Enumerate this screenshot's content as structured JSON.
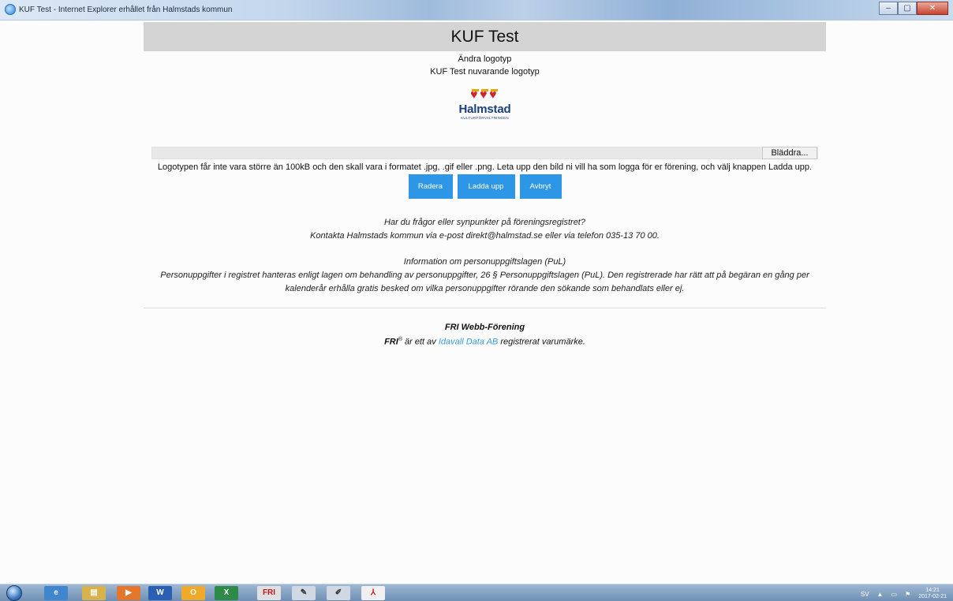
{
  "window": {
    "title": "KUF Test - Internet Explorer erhållet från Halmstads kommun",
    "controls": [
      "–",
      "▢",
      "✕"
    ]
  },
  "header": {
    "title": "KUF Test"
  },
  "logo_section": {
    "change_logo": "Ändra logotyp",
    "current_logo_label": "KUF Test nuvarande logotyp",
    "logo_name": "Halmstad",
    "logo_sub": "KULTURFÖRVALTNINGEN"
  },
  "upload": {
    "browse_label": "Bläddra...",
    "info_text": "Logotypen får inte vara större än 100kB och den skall vara i formatet .jpg, .gif eller .png. Leta upp den bild ni vill ha som logga för er förening, och välj knappen Ladda upp."
  },
  "buttons": {
    "delete": "Radera",
    "upload": "Ladda upp",
    "cancel": "Avbryt",
    "color": "#2d96e6"
  },
  "contact": {
    "line1": "Har du frågor eller synpunkter på föreningsregistret?",
    "line2": "Kontakta Halmstads kommun via e-post direkt@halmstad.se eller via telefon 035-13 70 00."
  },
  "pul": {
    "heading": "Information om personuppgiftslagen (PuL)",
    "text": "Personuppgifter i registret hanteras enligt lagen om behandling av personuppgifter, 26 § Personuppgiftslagen (PuL). Den registrerade har rätt att på begäran en gång per kalenderår erhålla gratis besked om vilka personuppgifter rörande den sökande som behandlats eller ej."
  },
  "footer": {
    "product": "FRI Webb-Förening",
    "brand": "FRI",
    "reg_mark": "®",
    "text_before": " är ett av ",
    "company_link": "Idavall Data AB",
    "text_after": " registrerat varumärke."
  },
  "taskbar": {
    "apps": [
      "ie-icon",
      "explorer-icon",
      "media-player-icon",
      "word-icon",
      "outlook-icon",
      "excel-icon",
      "fri-icon",
      "scanner-icon",
      "tool-icon",
      "pdf-icon"
    ],
    "language": "SV",
    "time": "14:21",
    "date": "2017-02-21"
  }
}
